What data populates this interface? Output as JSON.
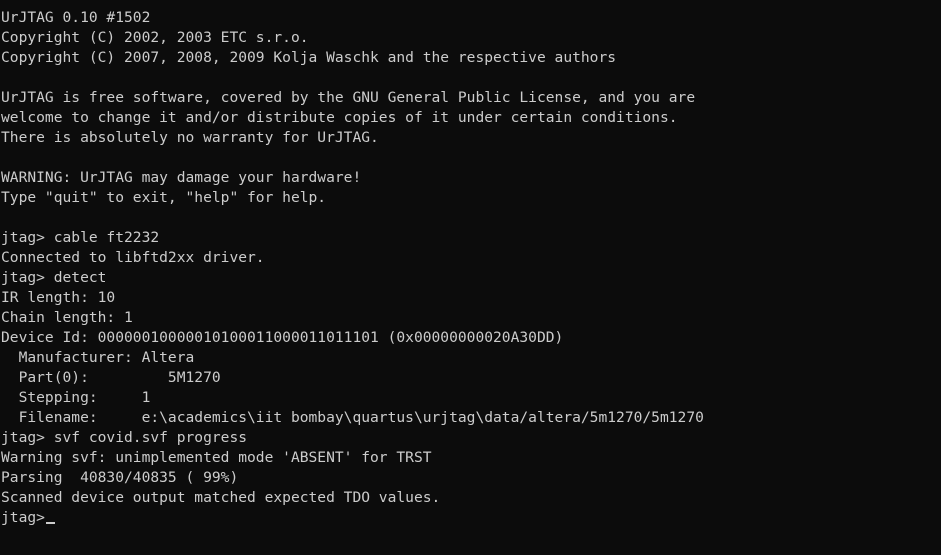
{
  "console": {
    "lines": [
      "UrJTAG 0.10 #1502",
      "Copyright (C) 2002, 2003 ETC s.r.o.",
      "Copyright (C) 2007, 2008, 2009 Kolja Waschk and the respective authors",
      "",
      "UrJTAG is free software, covered by the GNU General Public License, and you are",
      "welcome to change it and/or distribute copies of it under certain conditions.",
      "There is absolutely no warranty for UrJTAG.",
      "",
      "WARNING: UrJTAG may damage your hardware!",
      "Type \"quit\" to exit, \"help\" for help.",
      "",
      "jtag> cable ft2232",
      "Connected to libftd2xx driver.",
      "jtag> detect",
      "IR length: 10",
      "Chain length: 1",
      "Device Id: 00000010000010100011000011011101 (0x00000000020A30DD)",
      "  Manufacturer: Altera",
      "  Part(0):         5M1270",
      "  Stepping:     1",
      "  Filename:     e:\\academics\\iit bombay\\quartus\\urjtag\\data/altera/5m1270/5m1270",
      "jtag> svf covid.svf progress",
      "Warning svf: unimplemented mode 'ABSENT' for TRST",
      "Parsing  40830/40835 ( 99%)",
      "Scanned device output matched expected TDO values."
    ],
    "prompt": "jtag>"
  },
  "colors": {
    "background": "#0c0c0c",
    "foreground": "#cccccc"
  }
}
